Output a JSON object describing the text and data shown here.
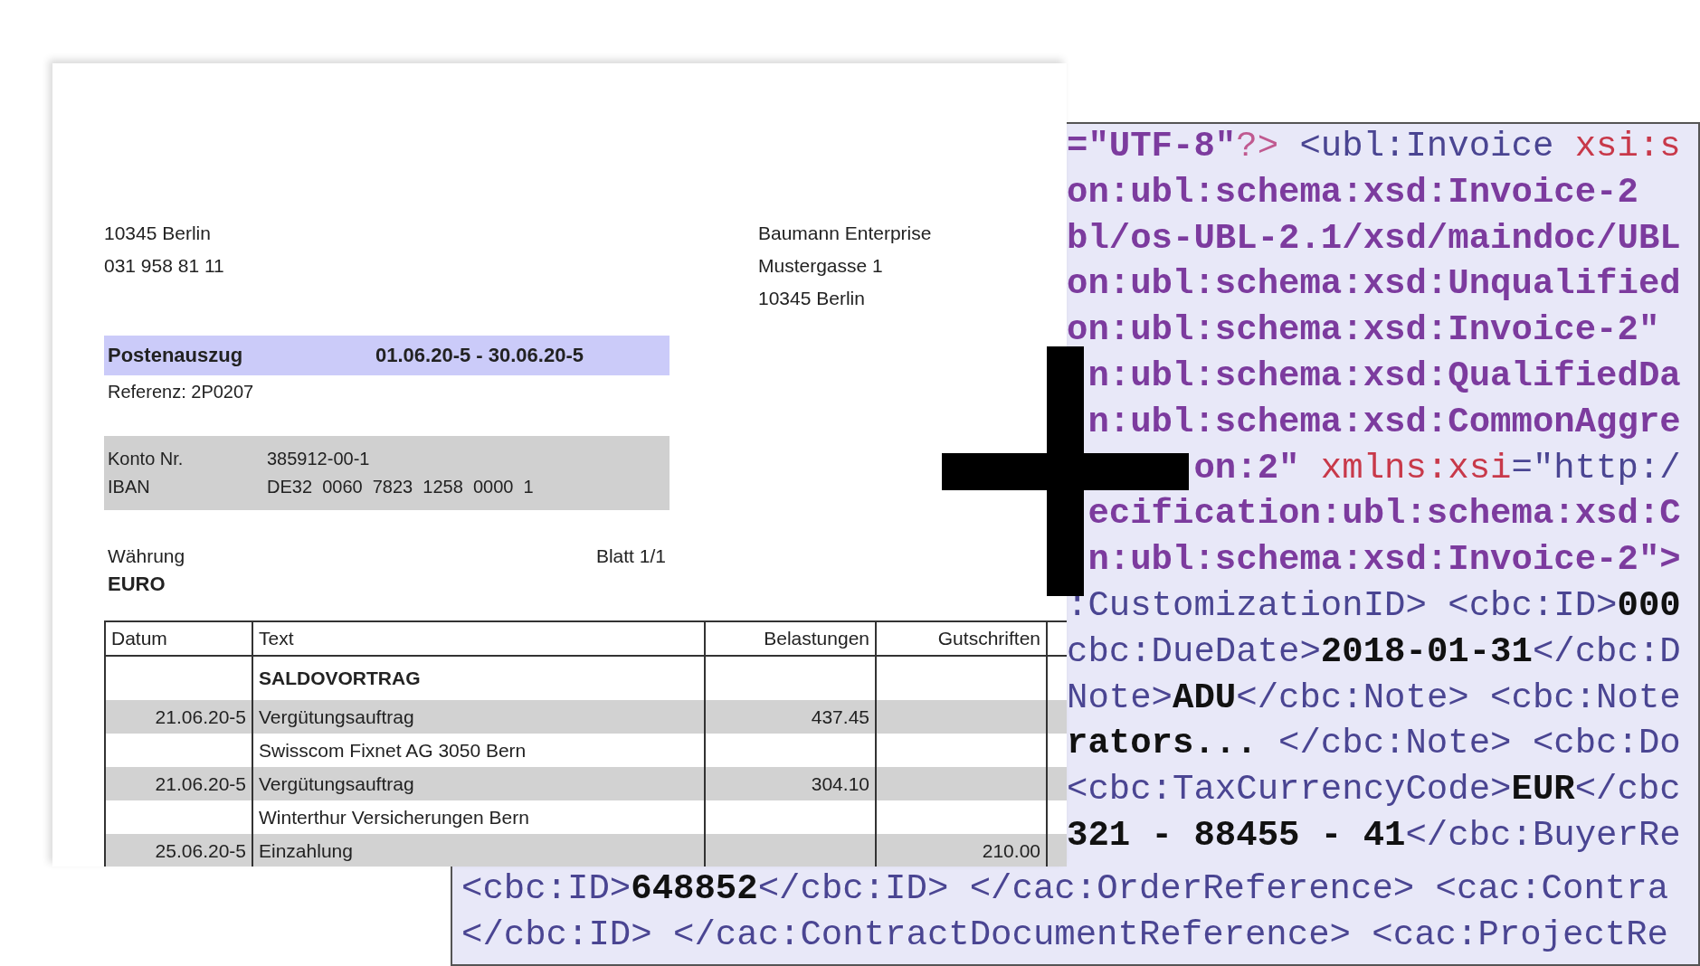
{
  "document": {
    "sender": [
      "10345 Berlin",
      "031 958 81 11"
    ],
    "recipient": [
      "Baumann Enterprise",
      "Mustergasse 1",
      "10345 Berlin"
    ],
    "statement": {
      "title": "Postenauszug",
      "period": "01.06.20-5 - 30.06.20-5",
      "reference": "Referenz: 2P0207"
    },
    "account": [
      {
        "label": "Konto Nr.",
        "value": "385912-00-1"
      },
      {
        "label": "IBAN",
        "value": "DE32  0060  7823  1258  0000  1"
      }
    ],
    "currency": {
      "label": "Währung",
      "value": "EURO"
    },
    "page": "Blatt 1/1",
    "table": {
      "columns": [
        "Datum",
        "Text",
        "Belastungen",
        "Gutschriften"
      ],
      "rows": [
        {
          "kind": "carryover",
          "date": "",
          "text": "SALDOVORTRAG",
          "debit": "",
          "credit": ""
        },
        {
          "kind": "entry",
          "date": "21.06.20-5",
          "text": "Vergütungsauftrag",
          "debit": "437.45",
          "credit": ""
        },
        {
          "kind": "detail",
          "date": "",
          "text": "Swisscom Fixnet AG 3050 Bern",
          "debit": "",
          "credit": ""
        },
        {
          "kind": "entry",
          "date": "21.06.20-5",
          "text": "Vergütungsauftrag",
          "debit": "304.10",
          "credit": ""
        },
        {
          "kind": "detail",
          "date": "",
          "text": "Winterthur Versicherungen Bern",
          "debit": "",
          "credit": ""
        },
        {
          "kind": "entry",
          "date": "25.06.20-5",
          "text": "Einzahlung",
          "debit": "",
          "credit": "210.00"
        }
      ]
    }
  },
  "code_view": {
    "lines": [
      [
        {
          "kind": "value",
          "text": "=\"UTF-8\""
        },
        {
          "kind": "pi",
          "text": "?>"
        },
        {
          "kind": "markup",
          "text": " <ubl:Invoice "
        },
        {
          "kind": "attr",
          "text": "xsi:s"
        }
      ],
      [
        {
          "kind": "value",
          "text": "on:ubl:schema:xsd:Invoice-2"
        }
      ],
      [
        {
          "kind": "value",
          "text": "bl/os-UBL-2.1/xsd/maindoc/UBL"
        }
      ],
      [
        {
          "kind": "value",
          "text": "on:ubl:schema:xsd:Unqualified"
        }
      ],
      [
        {
          "kind": "value",
          "text": "on:ubl:schema:xsd:Invoice-2\""
        }
      ],
      [
        {
          "kind": "value",
          "text": " n:ubl:schema:xsd:QualifiedDa"
        }
      ],
      [
        {
          "kind": "value",
          "text": " n:ubl:schema:xsd:CommonAggre"
        }
      ],
      [
        {
          "kind": "value",
          "text": "      on:2\" "
        },
        {
          "kind": "attr",
          "text": "xmlns:xsi"
        },
        {
          "kind": "markup",
          "text": "=\"http:/"
        }
      ],
      [
        {
          "kind": "value",
          "text": " ecification:ubl:schema:xsd:C"
        }
      ],
      [
        {
          "kind": "value",
          "text": " n:ubl:schema:xsd:Invoice-2\">"
        }
      ],
      [
        {
          "kind": "markup",
          "text": ":CustomizationID> <cbc:ID>"
        },
        {
          "kind": "content",
          "text": "000"
        }
      ],
      [
        {
          "kind": "markup",
          "text": "cbc:DueDate>"
        },
        {
          "kind": "content",
          "text": "2018-01-31"
        },
        {
          "kind": "markup",
          "text": "</cbc:D"
        }
      ],
      [
        {
          "kind": "markup",
          "text": "Note>"
        },
        {
          "kind": "content",
          "text": "ADU"
        },
        {
          "kind": "markup",
          "text": "</cbc:Note> <cbc:Note"
        }
      ],
      [
        {
          "kind": "content",
          "text": "rators... "
        },
        {
          "kind": "markup",
          "text": "</cbc:Note> <cbc:Do"
        }
      ],
      [
        {
          "kind": "markup",
          "text": "<cbc:TaxCurrencyCode>"
        },
        {
          "kind": "content",
          "text": "EUR"
        },
        {
          "kind": "markup",
          "text": "</cbc"
        }
      ],
      [
        {
          "kind": "content",
          "text": "321 - 88455 - 41"
        },
        {
          "kind": "markup",
          "text": "</cbc:BuyerRe"
        }
      ]
    ],
    "bottom_lines": [
      [
        {
          "kind": "markup",
          "text": "<cbc:ID>"
        },
        {
          "kind": "content",
          "text": "648852"
        },
        {
          "kind": "markup",
          "text": "</cbc:ID> </cac:OrderReference> <cac:Contra"
        }
      ],
      [
        {
          "kind": "markup",
          "text": "</cbc:ID> </cac:ContractDocumentReference> <cac:ProjectRe"
        }
      ]
    ]
  }
}
